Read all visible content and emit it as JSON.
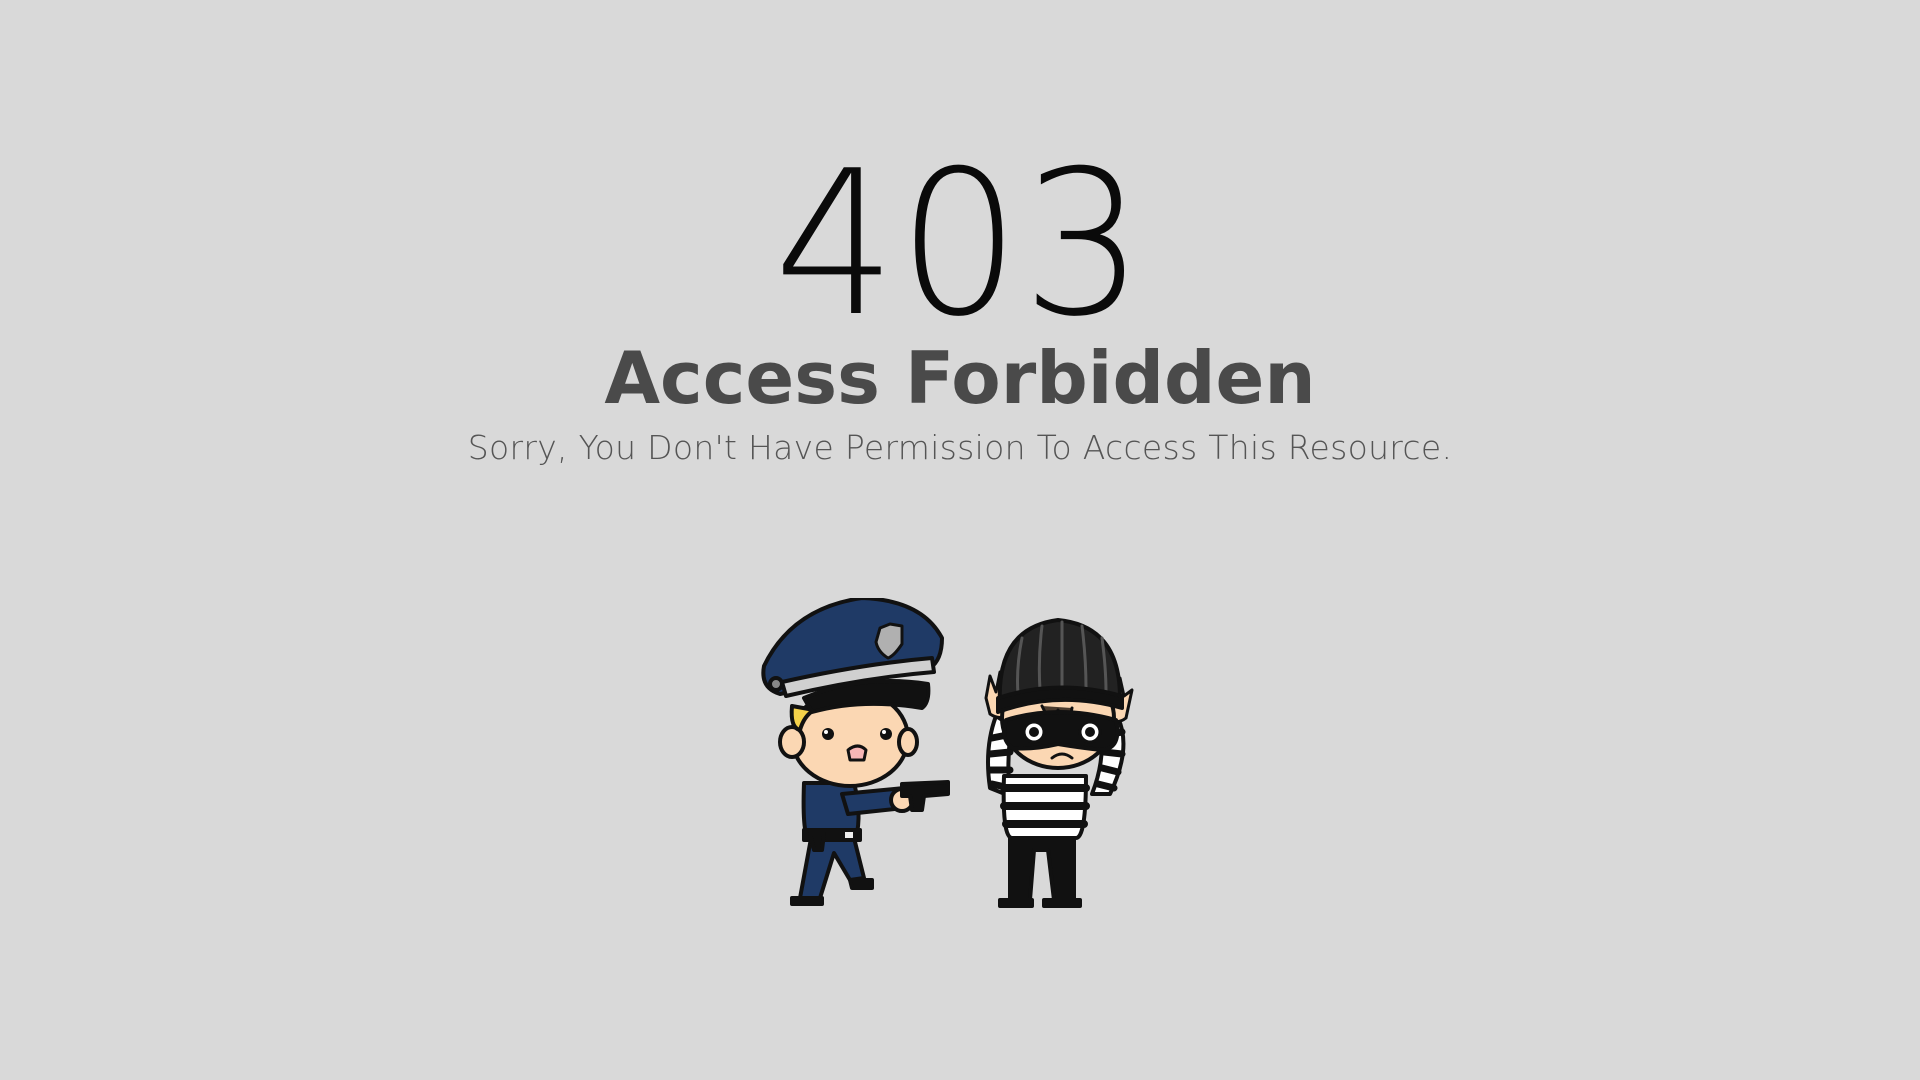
{
  "error": {
    "code": "403",
    "title": "Access Forbidden",
    "message": "Sorry, You Don't Have Permission To Access This Resource."
  },
  "illustration": {
    "figures": [
      "police-officer-icon",
      "burglar-icon"
    ],
    "colors": {
      "background": "#d9d9d9",
      "uniform": "#1f3a66",
      "hair": "#f5d24a",
      "skin": "#fbd7b3",
      "badge": "#b0b0b0",
      "outline": "#111111"
    }
  }
}
